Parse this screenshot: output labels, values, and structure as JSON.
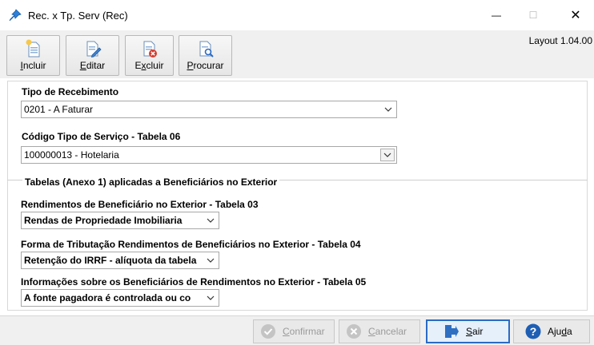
{
  "window": {
    "title": "Rec. x Tp. Serv (Rec)",
    "minimize": "—",
    "maximize": "☐",
    "close": "✕"
  },
  "toolbar": {
    "incluir": {
      "underline": "I",
      "rest": "ncluir"
    },
    "editar": {
      "underline": "E",
      "rest": "ditar"
    },
    "excluir": {
      "pre": "E",
      "underline": "x",
      "rest": "cluir"
    },
    "procurar": {
      "underline": "P",
      "rest": "rocurar"
    },
    "layout_version": "Layout 1.04.00"
  },
  "form": {
    "tipo_recebimento_label": "Tipo de Recebimento",
    "tipo_recebimento_value": "0201 - A Faturar",
    "codigo_servico_label": "Código Tipo de Serviço - Tabela 06",
    "codigo_servico_value": "100000013 - Hotelaria",
    "section_title": "Tabelas (Anexo 1) aplicadas a Beneficiários no Exterior",
    "rendimentos_label": "Rendimentos de Beneficiário no Exterior - Tabela 03",
    "rendimentos_value": "Rendas de Propriedade Imobiliaria",
    "tributacao_label": "Forma de Tributação Rendimentos de Beneficiários no Exterior - Tabela 04",
    "tributacao_value": "Retenção do IRRF - alíquota da tabela",
    "informacoes_label": "Informações sobre os Beneficiários de Rendimentos no Exterior - Tabela 05",
    "informacoes_value": "A fonte pagadora é controlada ou co"
  },
  "buttons": {
    "confirmar": {
      "underline": "C",
      "rest": "onfirmar"
    },
    "cancelar": {
      "underline": "C",
      "rest": "ancelar"
    },
    "sair": {
      "underline": "S",
      "rest": "air"
    },
    "ajuda": {
      "pre": "Aju",
      "underline": "d",
      "rest": "a"
    }
  },
  "colors": {
    "accent": "#2a6bc4",
    "help_icon": "#1e5fb4",
    "delete_badge": "#d83a2c",
    "disabled": "#9a9a9a"
  },
  "icons": [
    "pin-icon",
    "new-document-icon",
    "edit-document-icon",
    "delete-document-icon",
    "search-document-icon",
    "check-icon",
    "cancel-icon",
    "exit-icon",
    "help-icon"
  ]
}
